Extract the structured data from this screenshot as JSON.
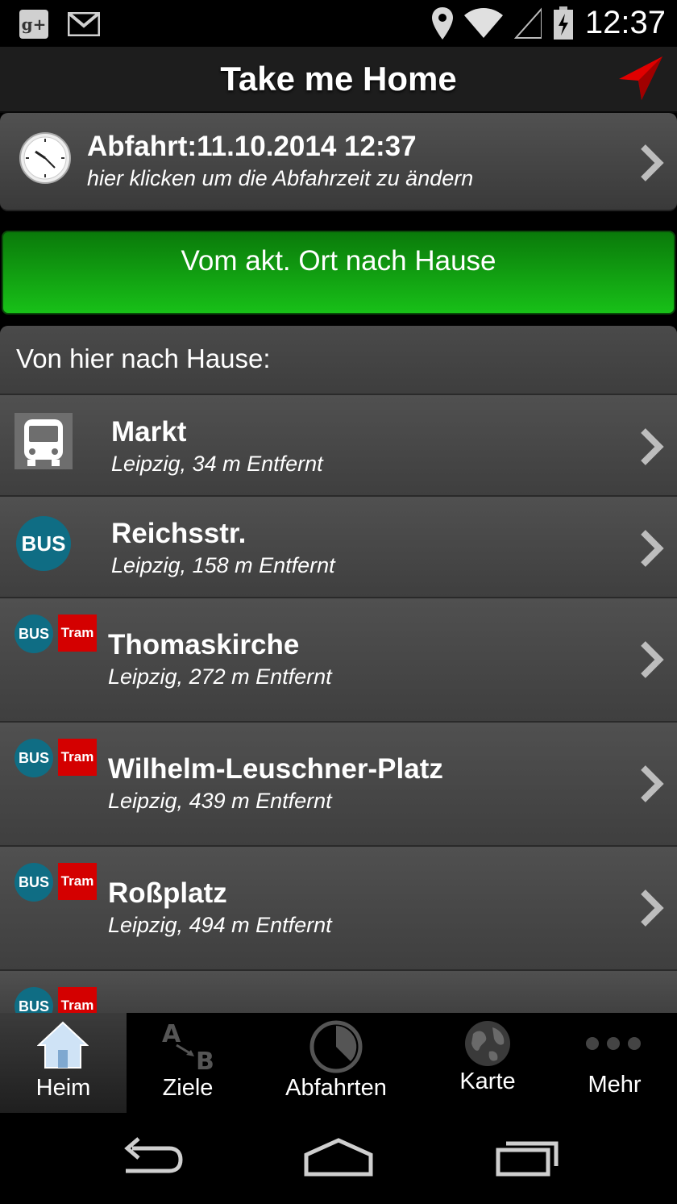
{
  "status_bar": {
    "time": "12:37",
    "icons": [
      "google-plus-icon",
      "gmail-icon",
      "location-icon",
      "wifi-icon",
      "signal-icon",
      "battery-charging-icon"
    ],
    "gplus_label": "g+"
  },
  "header": {
    "title": "Take me Home",
    "nav_icon": "navigation-arrow-icon",
    "accent_color": "#e00000"
  },
  "departure": {
    "title": "Abfahrt:11.10.2014 12:37",
    "subtitle": "hier klicken um die Abfahrzeit zu ändern"
  },
  "go_button": {
    "label": "Vom akt. Ort nach Hause",
    "color": "#12a012"
  },
  "stops": {
    "heading": "Von hier nach Hause:",
    "items": [
      {
        "name": "Markt",
        "distance": "Leipzig, 34 m Entfernt",
        "icon": "bus-stop-icon"
      },
      {
        "name": "Reichsstr.",
        "distance": "Leipzig, 158 m Entfernt",
        "icon": "bus-icon",
        "badge": "BUS"
      },
      {
        "name": "Thomaskirche",
        "distance": "Leipzig, 272 m Entfernt",
        "icon": "bus-tram-icon",
        "badges": [
          "BUS",
          "Tram"
        ]
      },
      {
        "name": "Wilhelm-Leuschner-Platz",
        "distance": "Leipzig, 439 m Entfernt",
        "icon": "bus-tram-icon",
        "badges": [
          "BUS",
          "Tram"
        ]
      },
      {
        "name": "Roßplatz",
        "distance": "Leipzig, 494 m Entfernt",
        "icon": "bus-tram-icon",
        "badges": [
          "BUS",
          "Tram"
        ]
      },
      {
        "name": "",
        "distance": "",
        "icon": "bus-tram-icon",
        "badges": [
          "BUS",
          "Tram"
        ]
      }
    ],
    "bus_color": "#0f6d84",
    "tram_color": "#d40000"
  },
  "tabs": [
    {
      "label": "Heim",
      "icon": "home-icon",
      "active": true
    },
    {
      "label": "Ziele",
      "icon": "a-to-b-icon",
      "active": false
    },
    {
      "label": "Abfahrten",
      "icon": "clock-pie-icon",
      "active": false
    },
    {
      "label": "Karte",
      "icon": "globe-icon",
      "active": false
    },
    {
      "label": "Mehr",
      "icon": "more-dots-icon",
      "active": false
    }
  ],
  "nav_bar": {
    "buttons": [
      "back-icon",
      "home-nav-icon",
      "recents-icon"
    ]
  }
}
